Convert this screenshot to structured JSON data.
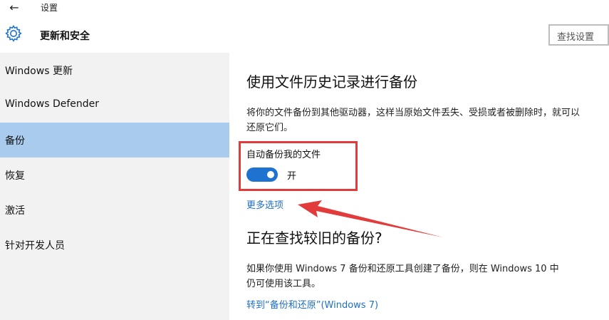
{
  "titlebar": {
    "back_glyph": "←",
    "title": "设置"
  },
  "header": {
    "section_title": "更新和安全",
    "search_placeholder": "查找设置"
  },
  "sidebar": {
    "items": [
      {
        "label": "Windows 更新",
        "selected": false
      },
      {
        "label": "Windows Defender",
        "selected": false
      },
      {
        "label": "备份",
        "selected": true
      },
      {
        "label": "恢复",
        "selected": false
      },
      {
        "label": "激活",
        "selected": false
      },
      {
        "label": "针对开发人员",
        "selected": false
      }
    ]
  },
  "content": {
    "heading1": "使用文件历史记录进行备份",
    "description1": "将你的文件备份到其他驱动器，这样当原始文件丢失、受损或者被删除时，就可以还原它们。",
    "toggle_label": "自动备份我的文件",
    "toggle_state": "开",
    "more_options": "更多选项",
    "heading2": "正在查找较旧的备份?",
    "description2": "如果你使用 Windows 7 备份和还原工具创建了备份，则在 Windows 10 中仍可使用该工具。",
    "goto_link": "转到“备份和还原”(Windows 7)"
  },
  "colors": {
    "selected_nav": "#a9cbee",
    "toggle_on": "#1f73d0",
    "link": "#1f6fc5",
    "annotation_red": "#e23b3b"
  }
}
